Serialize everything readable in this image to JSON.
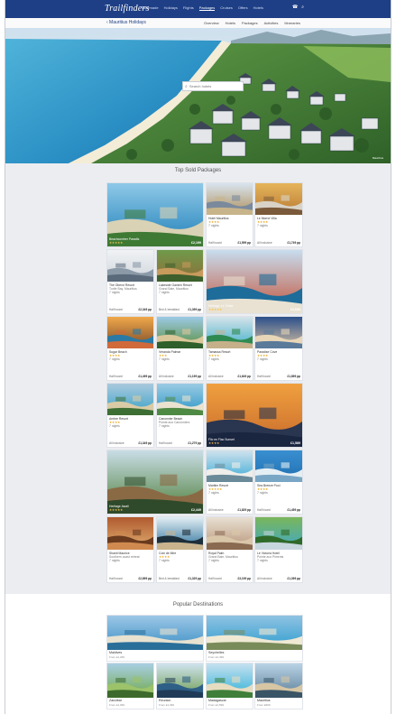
{
  "header": {
    "logo": "Trailfinders",
    "menu": [
      "Tailormade",
      "Holidays",
      "Flights",
      "Packages",
      "Cruises",
      "Offers",
      "Hotels"
    ],
    "active_menu_index": 3,
    "icons": [
      "phone-icon",
      "search-icon"
    ],
    "brand_color": "#1e3f86"
  },
  "subbar": {
    "back_label": "‹ Mauritius Holidays",
    "links": [
      "Overview",
      "Hotels",
      "Packages",
      "Activities",
      "Itineraries"
    ]
  },
  "hero": {
    "search_placeholder": "Search hotels",
    "caption": "Mauritius"
  },
  "top_section": {
    "title": "Top Sold Packages"
  },
  "packages": [
    {
      "name": "Beachcomber Paradis",
      "stars": "★★★★★",
      "price": "£2,199"
    },
    {
      "name": "Hotel Mauritius",
      "stars": "★★★★",
      "price": "£1,599",
      "board": "Half board",
      "nights": "7 nights"
    },
    {
      "name": "Le Morne Villa",
      "stars": "★★★★",
      "price": "£1,749",
      "board": "All inclusive",
      "nights": "7 nights"
    },
    {
      "name": "The Oberoi Resort",
      "sub": "Turtle Bay, Mauritius",
      "price": "£2,349",
      "board": "Half board",
      "nights": "7 nights"
    },
    {
      "name": "Lakeside Garden Resort",
      "sub": "Grand Baie, Mauritius",
      "price": "£1,399",
      "board": "Bed & breakfast",
      "nights": "7 nights"
    },
    {
      "name": "Heritage Le Telfair",
      "stars": "★★★★★",
      "price": "£2,699"
    },
    {
      "name": "Sugar Beach",
      "stars": "★★★★",
      "price": "£1,499",
      "board": "Half board",
      "nights": "7 nights"
    },
    {
      "name": "Veranda Palmar",
      "stars": "★★★",
      "price": "£1,199",
      "board": "All inclusive",
      "nights": "7 nights"
    },
    {
      "name": "Tamassa Resort",
      "stars": "★★★★",
      "price": "£1,649",
      "board": "All inclusive",
      "nights": "7 nights"
    },
    {
      "name": "Paradise Cove",
      "stars": "★★★★",
      "price": "£1,899",
      "board": "Half board",
      "nights": "7 nights"
    },
    {
      "name": "Ambre Resort",
      "stars": "★★★★",
      "price": "£1,349",
      "board": "All inclusive",
      "nights": "7 nights"
    },
    {
      "name": "Canonnier Beach",
      "sub": "Pointe aux Canonniers",
      "price": "£1,279",
      "board": "Half board",
      "nights": "7 nights"
    },
    {
      "name": "Flic en Flac Sunset",
      "stars": "★★★★",
      "price": "£1,589"
    },
    {
      "name": "Heritage Awali",
      "stars": "★★★★★",
      "price": "£2,449"
    },
    {
      "name": "Maritim Resort",
      "stars": "★★★★★",
      "price": "£1,829",
      "board": "All inclusive",
      "nights": "7 nights"
    },
    {
      "name": "Sea Breeze Pool",
      "stars": "★★★★",
      "price": "£1,459",
      "board": "Half board",
      "nights": "7 nights"
    },
    {
      "name": "Shanti Maurice",
      "sub": "Southern coast retreat",
      "price": "£2,899",
      "board": "Half board",
      "nights": "7 nights"
    },
    {
      "name": "Coin de Mire",
      "stars": "★★★★",
      "price": "£1,329",
      "board": "Bed & breakfast",
      "nights": "7 nights"
    },
    {
      "name": "Royal Palm",
      "sub": "Grand Baie, Mauritius",
      "price": "£3,199",
      "board": "Half board",
      "nights": "7 nights"
    },
    {
      "name": "Le Victoria Hotel",
      "sub": "Pointe aux Piments",
      "price": "£1,399",
      "board": "All inclusive",
      "nights": "7 nights"
    }
  ],
  "popular": {
    "title": "Popular Destinations",
    "items": [
      {
        "name": "Maldives",
        "sub": "From £1,299"
      },
      {
        "name": "Seychelles",
        "sub": "From £1,499"
      },
      {
        "name": "Zanzibar",
        "sub": "From £1,099"
      },
      {
        "name": "Reunion",
        "sub": "From £1,399"
      },
      {
        "name": "Madagascar",
        "sub": "From £1,599"
      },
      {
        "name": "Mauritius",
        "sub": "From £999"
      }
    ]
  },
  "labels": {
    "per_person": "pp"
  }
}
